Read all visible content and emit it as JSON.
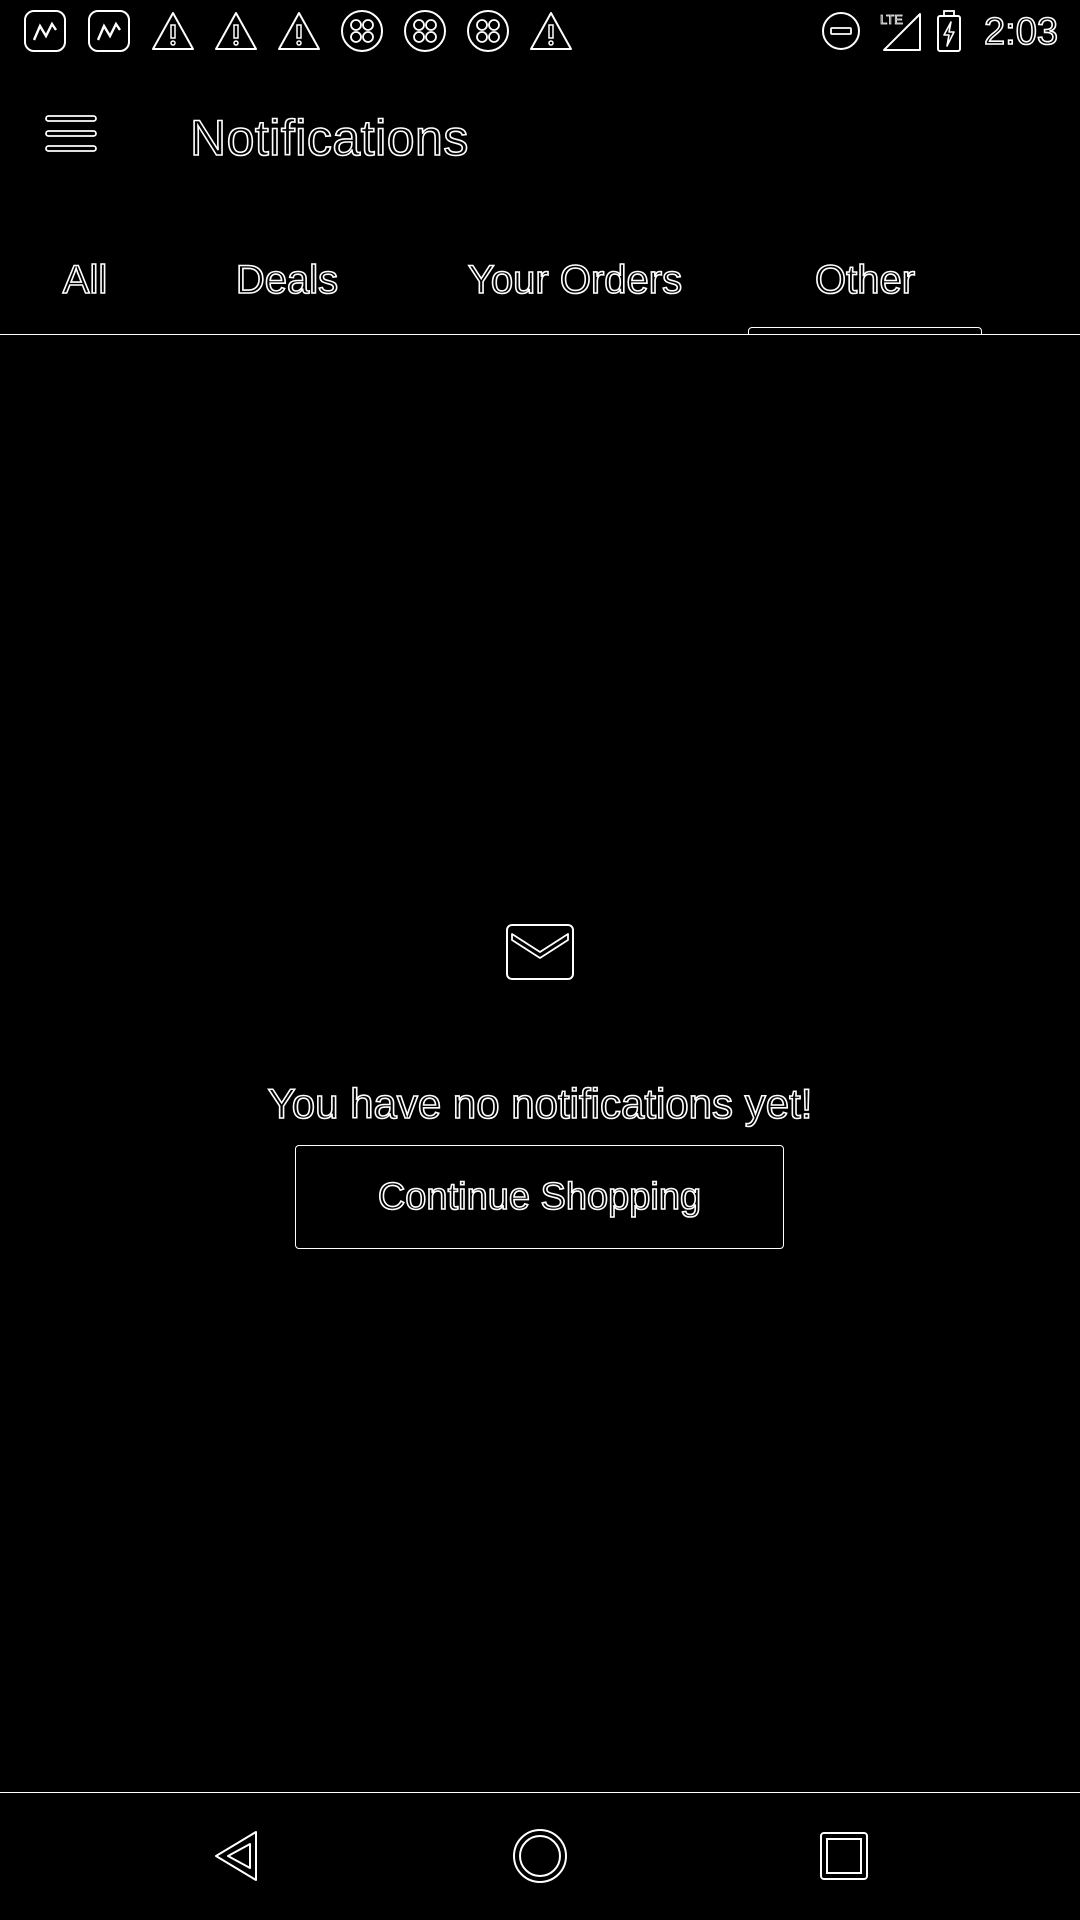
{
  "status_bar": {
    "time": "2:03",
    "left_icons": [
      "app-notification-icon",
      "app-notification-icon",
      "warning-icon",
      "warning-icon",
      "warning-icon",
      "clover-app-icon",
      "clover-app-icon",
      "clover-app-icon",
      "warning-icon"
    ],
    "right_icons": [
      "do-not-disturb-icon",
      "lte-signal-icon",
      "battery-charging-icon"
    ],
    "lte_label": "LTE"
  },
  "app_bar": {
    "title": "Notifications",
    "menu_icon": "hamburger-menu-icon"
  },
  "tabs": [
    {
      "label": "All",
      "selected": false
    },
    {
      "label": "Deals",
      "selected": false
    },
    {
      "label": "Your Orders",
      "selected": false
    },
    {
      "label": "Other",
      "selected": true
    }
  ],
  "empty_state": {
    "icon": "envelope-icon",
    "message": "You have no notifications yet!",
    "button_label": "Continue Shopping"
  },
  "nav_bar": {
    "icons": [
      "back-triangle-icon",
      "home-circle-icon",
      "recents-square-icon"
    ]
  },
  "colors": {
    "background": "#000000",
    "outline": "#ffffff"
  }
}
